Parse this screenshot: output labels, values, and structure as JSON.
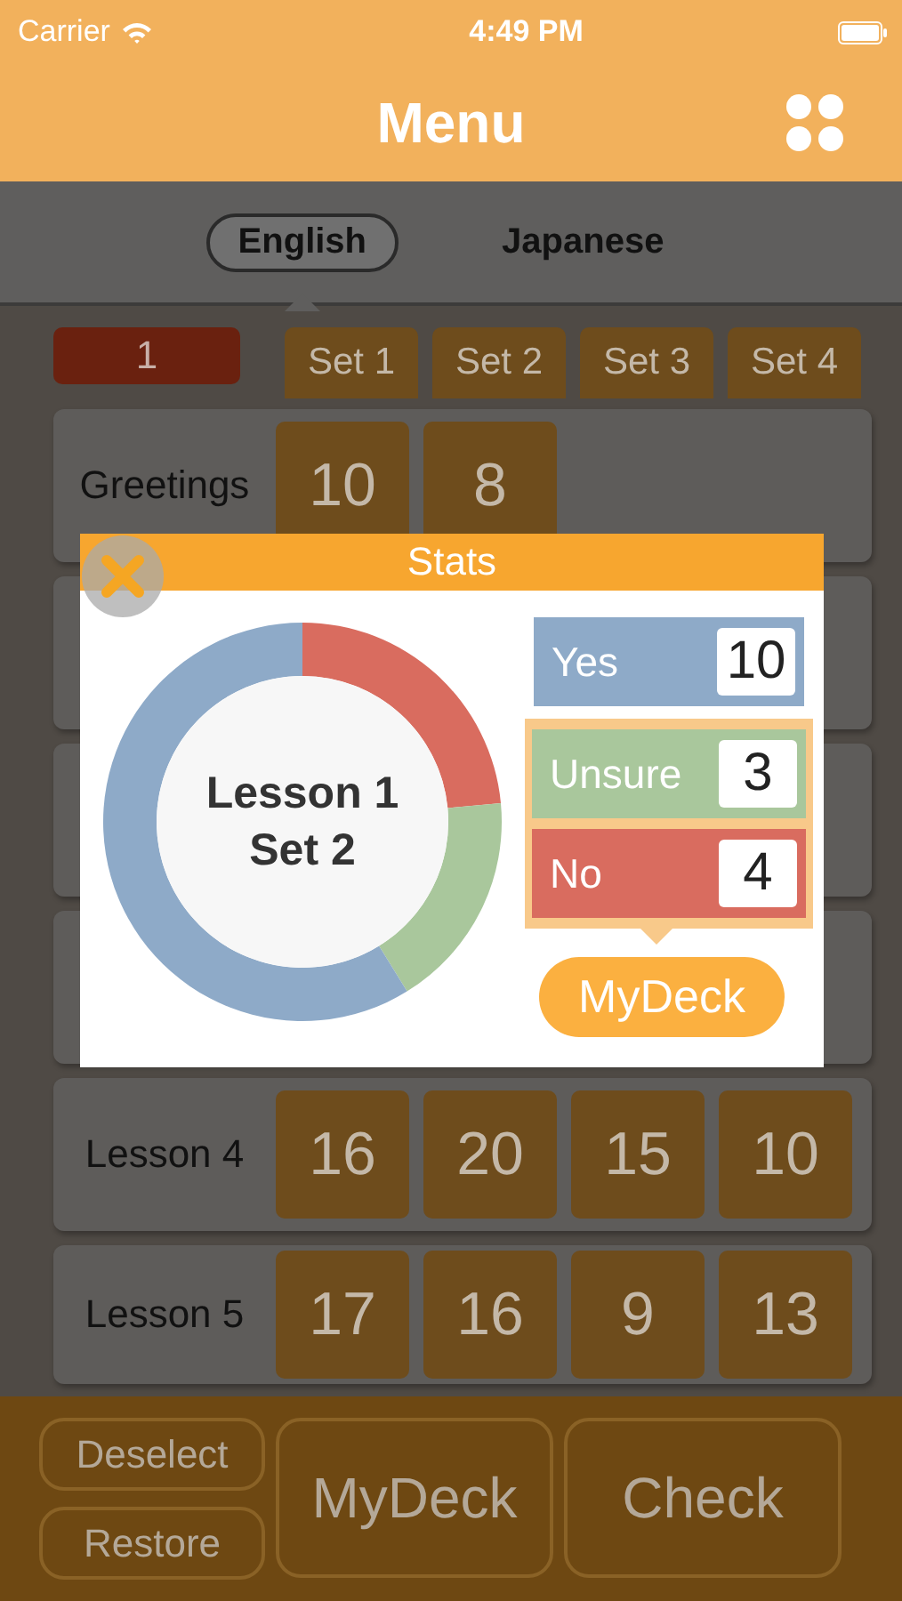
{
  "status_bar": {
    "carrier": "Carrier",
    "time": "4:49 PM"
  },
  "nav": {
    "title": "Menu"
  },
  "tabs": [
    {
      "label": "English",
      "selected": true
    },
    {
      "label": "Japanese",
      "selected": false
    }
  ],
  "grid": {
    "level_badge": "1",
    "columns": [
      "Set 1",
      "Set 2",
      "Set 3",
      "Set 4"
    ],
    "rows": [
      {
        "lesson": "Greetings",
        "cells": [
          "10",
          "8"
        ]
      },
      {
        "lesson": "Lesson 4",
        "cells": [
          "16",
          "20",
          "15",
          "10"
        ]
      },
      {
        "lesson": "Lesson 5",
        "cells": [
          "17",
          "16",
          "9",
          "13"
        ]
      }
    ]
  },
  "bottom_bar": {
    "buttons": [
      {
        "label": "Deselect",
        "kind": "small"
      },
      {
        "label": "Restore",
        "kind": "small"
      },
      {
        "label": "MyDeck",
        "kind": "large"
      },
      {
        "label": "Check",
        "kind": "large"
      }
    ]
  },
  "stats_dialog": {
    "title": "Stats",
    "center_lines": [
      "Lesson 1",
      "Set 2"
    ],
    "chart_data": {
      "type": "donut",
      "categories": [
        "Yes",
        "Unsure",
        "No"
      ],
      "values": [
        58.8,
        17.7,
        23.5
      ]
    },
    "answers": [
      {
        "count": "10",
        "color": "#8eaac8",
        "selected": false
      },
      {
        "count": "3",
        "color": "#a9c79c",
        "selected": true
      },
      {
        "count": "4",
        "color": "#d96c5f",
        "selected": true
      }
    ],
    "action": "MyDeck"
  }
}
